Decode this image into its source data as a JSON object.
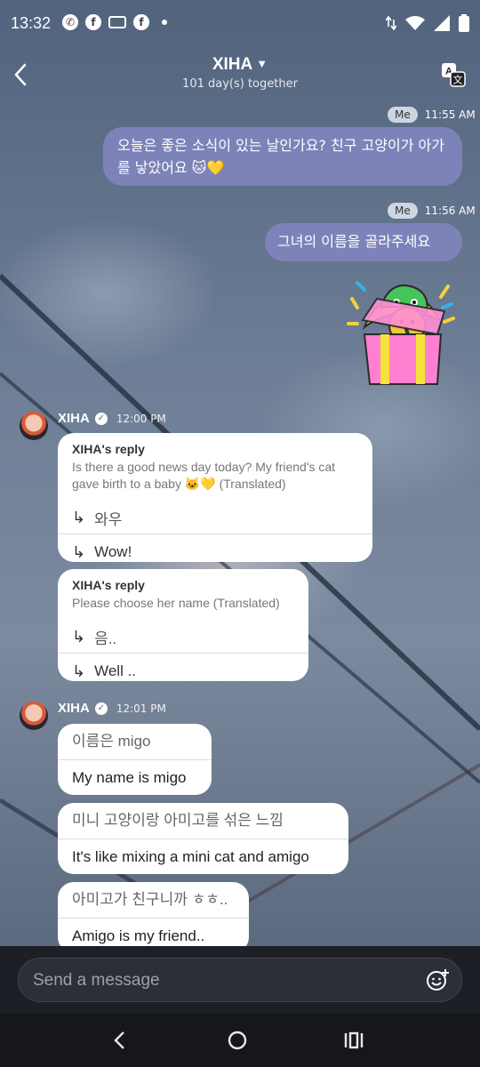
{
  "status_bar": {
    "time": "13:32",
    "notification_icons": [
      "whatsapp-icon",
      "facebook-icon",
      "messenger-bubble-icon",
      "facebook-icon",
      "more-dot-icon"
    ],
    "system_icons": [
      "data-arrows-icon",
      "wifi-icon",
      "signal-icon",
      "battery-icon"
    ]
  },
  "header": {
    "title": "XIHA",
    "subtitle": "101 day(s) together",
    "back_icon": "back-arrow-icon",
    "translate_icon": "translate-icon"
  },
  "messages_me": [
    {
      "tag": "Me",
      "time": "11:55 AM",
      "text": "오늘은 좋은 소식이 있는 날인가요? 친구 고양이가 아가를 낳았어요 🐱💛"
    },
    {
      "tag": "Me",
      "time": "11:56 AM",
      "text": "그녀의 이름을 골라주세요"
    }
  ],
  "sticker": {
    "name": "gift-box-sticker"
  },
  "xiha_group1": {
    "name": "XIHA",
    "time": "12:00 PM",
    "cards": [
      {
        "title": "XIHA's reply",
        "quote": "Is there a good news day today? My friend's cat gave birth to a baby 🐱💛 (Translated)",
        "original": "와우",
        "translated": "Wow!"
      },
      {
        "title": "XIHA's reply",
        "quote": "Please choose her name (Translated)",
        "original": "음..",
        "translated": "Well .."
      }
    ]
  },
  "xiha_group2": {
    "name": "XIHA",
    "time": "12:01 PM",
    "bubbles": [
      {
        "original": "이름은 migo",
        "translated": "My name is migo"
      },
      {
        "original": "미니 고양이랑 아미고를 섞은 느낌",
        "translated": "It's like mixing a mini cat and amigo"
      },
      {
        "original": "아미고가 친구니까 ㅎㅎ..",
        "translated": "Amigo is my friend.."
      }
    ]
  },
  "input": {
    "placeholder": "Send a message",
    "value": ""
  },
  "nav": [
    "back-nav-icon",
    "home-nav-icon",
    "recents-nav-icon"
  ],
  "colors": {
    "me_bubble": "#7d83b8",
    "input_bar": "#1c1f26"
  }
}
